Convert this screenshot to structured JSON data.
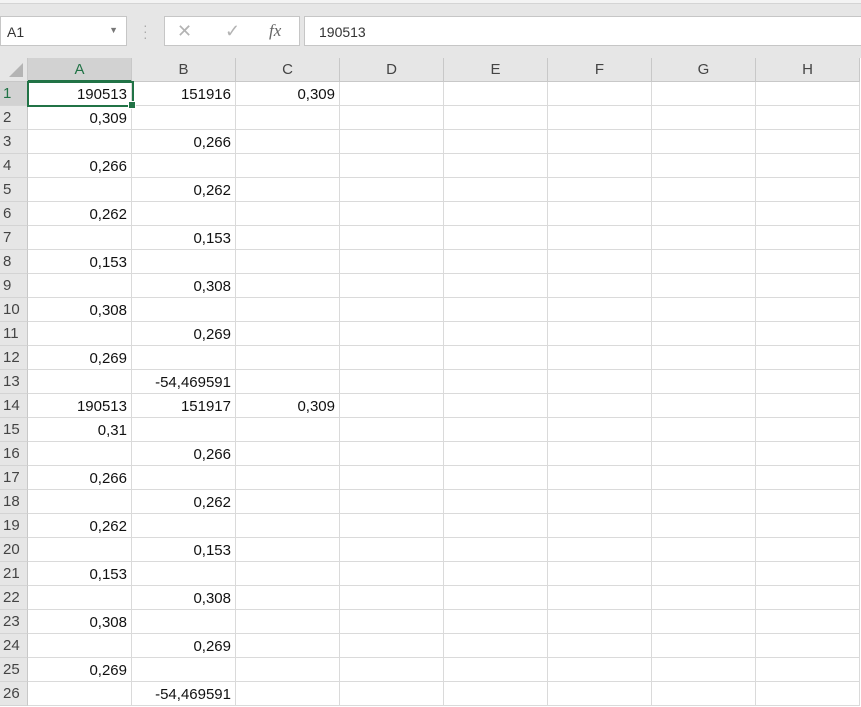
{
  "name_box": "A1",
  "formula_value": "190513",
  "formula_icons": {
    "cancel": "✕",
    "enter": "✓",
    "fx": "fx"
  },
  "columns": [
    "A",
    "B",
    "C",
    "D",
    "E",
    "F",
    "G",
    "H"
  ],
  "selected_cell": "A1",
  "rows": [
    [
      "190513",
      "151916",
      "0,309"
    ],
    [
      "0,309",
      "",
      ""
    ],
    [
      "",
      "0,266",
      ""
    ],
    [
      "0,266",
      "",
      ""
    ],
    [
      "",
      "0,262",
      ""
    ],
    [
      "0,262",
      "",
      ""
    ],
    [
      "",
      "0,153",
      ""
    ],
    [
      "0,153",
      "",
      ""
    ],
    [
      "",
      "0,308",
      ""
    ],
    [
      "0,308",
      "",
      ""
    ],
    [
      "",
      "0,269",
      ""
    ],
    [
      "0,269",
      "",
      ""
    ],
    [
      "",
      "-54,469591",
      ""
    ],
    [
      "190513",
      "151917",
      "0,309"
    ],
    [
      "0,31",
      "",
      ""
    ],
    [
      "",
      "0,266",
      ""
    ],
    [
      "0,266",
      "",
      ""
    ],
    [
      "",
      "0,262",
      ""
    ],
    [
      "0,262",
      "",
      ""
    ],
    [
      "",
      "0,153",
      ""
    ],
    [
      "0,153",
      "",
      ""
    ],
    [
      "",
      "0,308",
      ""
    ],
    [
      "0,308",
      "",
      ""
    ],
    [
      "",
      "0,269",
      ""
    ],
    [
      "0,269",
      "",
      ""
    ],
    [
      "",
      "-54,469591",
      ""
    ]
  ]
}
